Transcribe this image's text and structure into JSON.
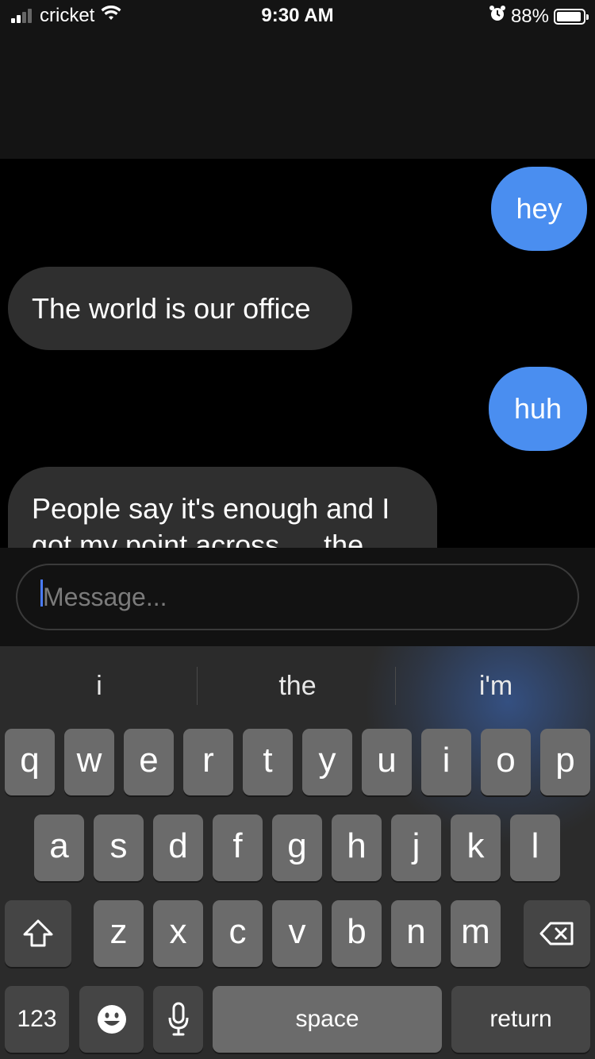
{
  "status": {
    "carrier": "cricket",
    "time": "9:30 AM",
    "battery_pct": "88%"
  },
  "messages": [
    {
      "from": "me",
      "text": "hey"
    },
    {
      "from": "them",
      "text": "The world is our office"
    },
    {
      "from": "me",
      "text": "huh"
    },
    {
      "from": "them",
      "text": "People say it's enough and I got my point across … the"
    }
  ],
  "composer": {
    "placeholder": "Message..."
  },
  "keyboard": {
    "suggestions": [
      "i",
      "the",
      "i'm"
    ],
    "row1": [
      "q",
      "w",
      "e",
      "r",
      "t",
      "y",
      "u",
      "i",
      "o",
      "p"
    ],
    "row2": [
      "a",
      "s",
      "d",
      "f",
      "g",
      "h",
      "j",
      "k",
      "l"
    ],
    "row3": [
      "z",
      "x",
      "c",
      "v",
      "b",
      "n",
      "m"
    ],
    "numbers_label": "123",
    "space_label": "space",
    "return_label": "return"
  },
  "colors": {
    "sent_bubble": "#4a8ef0",
    "received_bubble": "#2f2f2f",
    "caret": "#4a7cff"
  },
  "icons": {
    "shift": "shift-icon",
    "delete": "backspace-icon",
    "emoji": "emoji-icon",
    "mic": "microphone-icon",
    "alarm": "alarm-icon",
    "wifi": "wifi-icon"
  }
}
